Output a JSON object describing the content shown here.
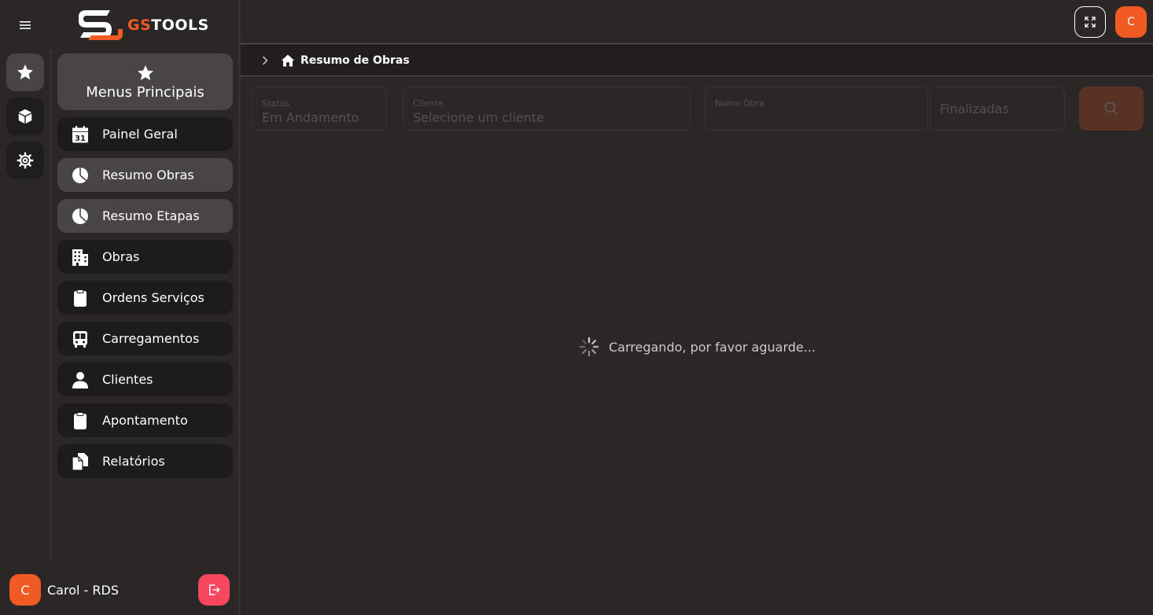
{
  "app": {
    "logo_gs": "GS",
    "logo_tools": "TOOLS"
  },
  "rail": {
    "items": [
      "star-icon",
      "box-icon",
      "gear-icon"
    ]
  },
  "menu": {
    "header_title": "Menus Principais",
    "items": [
      {
        "label": "Painel Geral",
        "icon": "calendar-icon"
      },
      {
        "label": "Resumo Obras",
        "icon": "pie-chart-icon"
      },
      {
        "label": "Resumo Etapas",
        "icon": "pie-chart-icon"
      },
      {
        "label": "Obras",
        "icon": "building-icon"
      },
      {
        "label": "Ordens Serviços",
        "icon": "clipboard-icon"
      },
      {
        "label": "Carregamentos",
        "icon": "bus-icon"
      },
      {
        "label": "Clientes",
        "icon": "user-icon"
      },
      {
        "label": "Apontamento",
        "icon": "clipboard-icon"
      },
      {
        "label": "Relatórios",
        "icon": "documents-icon"
      }
    ]
  },
  "calendar_day": "31",
  "user": {
    "initial": "C",
    "name": "Carol - RDS"
  },
  "topbar": {
    "avatar_initial": "C"
  },
  "breadcrumb": {
    "title": "Resumo de Obras"
  },
  "filters": {
    "status_label": "Status",
    "status_value": "Em Andamento",
    "cliente_label": "Cliente",
    "cliente_value": "Selecione um cliente",
    "nome_obra_label": "Nome Obra",
    "finalizadas_value": "Finalizadas"
  },
  "loading_text": "Carregando, por favor aguarde...",
  "colors": {
    "accent": "#f15a22",
    "logout": "#f7475f",
    "bg": "#2b2727"
  }
}
